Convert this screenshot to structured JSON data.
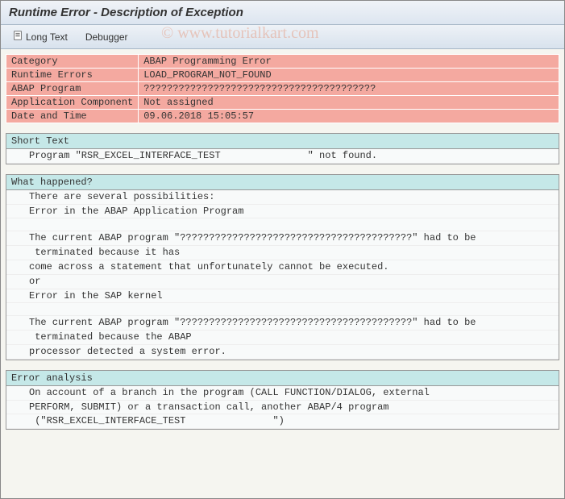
{
  "title": "Runtime Error - Description of Exception",
  "toolbar": {
    "long_text_label": "Long Text",
    "debugger_label": "Debugger"
  },
  "info_rows": [
    {
      "label": "Category",
      "value": "ABAP Programming Error"
    },
    {
      "label": "Runtime Errors",
      "value": "LOAD_PROGRAM_NOT_FOUND"
    },
    {
      "label": "ABAP Program",
      "value": "????????????????????????????????????????"
    },
    {
      "label": "Application Component",
      "value": "Not assigned"
    },
    {
      "label": "Date and Time",
      "value": "09.06.2018 15:05:57"
    }
  ],
  "short_text": {
    "header": "Short Text",
    "lines": [
      "Program \"RSR_EXCEL_INTERFACE_TEST               \" not found."
    ]
  },
  "what_happened": {
    "header": "What happened?",
    "lines": [
      "There are several possibilities:",
      "Error in the ABAP Application Program",
      "",
      "The current ABAP program \"????????????????????????????????????????\" had to be",
      " terminated because it has",
      "come across a statement that unfortunately cannot be executed.",
      "or",
      "Error in the SAP kernel",
      "",
      "The current ABAP program \"????????????????????????????????????????\" had to be",
      " terminated because the ABAP",
      "processor detected a system error."
    ]
  },
  "error_analysis": {
    "header": "Error analysis",
    "lines": [
      "On account of a branch in the program (CALL FUNCTION/DIALOG, external",
      "PERFORM, SUBMIT) or a transaction call, another ABAP/4 program",
      " (\"RSR_EXCEL_INTERFACE_TEST               \")"
    ]
  },
  "watermark": "© www.tutorialkart.com"
}
